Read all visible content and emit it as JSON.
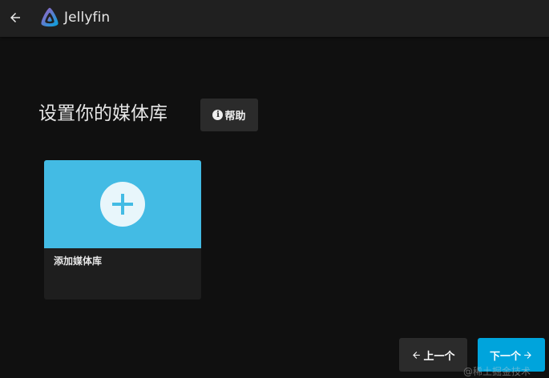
{
  "header": {
    "app_name": "Jellyfin",
    "back_icon": "arrow-left-icon",
    "logo_icon": "jellyfin-logo-icon"
  },
  "main": {
    "title": "设置你的媒体库",
    "help_button": {
      "label": "帮助",
      "icon": "info-icon"
    },
    "add_library_card": {
      "label": "添加媒体库",
      "icon": "plus-icon"
    }
  },
  "footer": {
    "prev_label": "上一个",
    "next_label": "下一个"
  },
  "watermark": "@稀土掘金技术",
  "colors": {
    "background": "#101010",
    "header": "#202020",
    "accent": "#00a4dc",
    "card_image": "#43bbe4"
  }
}
